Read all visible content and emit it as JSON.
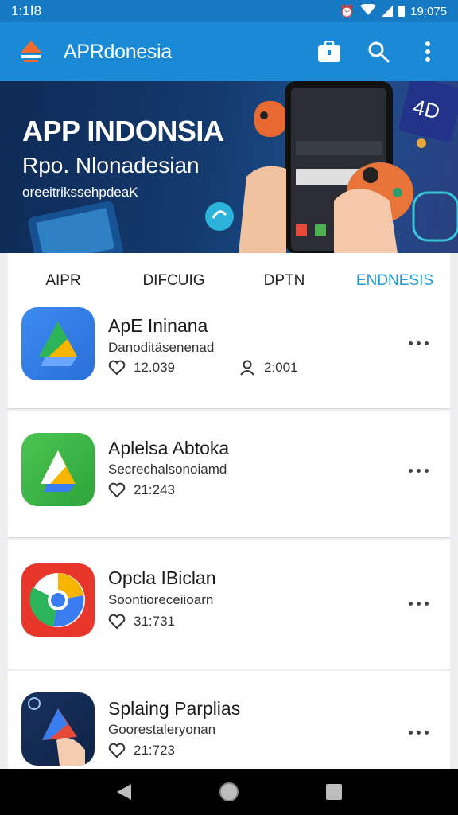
{
  "status_bar": {
    "time": "1:1Ⅰ8",
    "right_time": "19:075",
    "icons": [
      "alarm-icon",
      "wifi-icon",
      "signal-icon",
      "battery-icon"
    ]
  },
  "app_bar": {
    "title": "APRdonesia",
    "logo_icon": "app-logo-icon",
    "actions": [
      "briefcase-icon",
      "search-icon",
      "more-vert-icon"
    ]
  },
  "banner": {
    "title": "APP INDONSIA",
    "subtitle": "Rpo. Nlonadesian",
    "tagline": "oreeitrikssehpdeaK"
  },
  "tabs": [
    {
      "label": "AIPR",
      "active": false
    },
    {
      "label": "DIFCUIG",
      "active": false
    },
    {
      "label": "DPTN",
      "active": false
    },
    {
      "label": "ENDNESIS",
      "active": true
    }
  ],
  "apps": [
    {
      "name": "ApE  Ininana",
      "description": "Danoditäsenenad",
      "likes": "12.039",
      "users": "2:001",
      "icon": "drive-blue-icon"
    },
    {
      "name": "Aplelsa Abtoka",
      "description": "Secrechalsonoiamd",
      "likes": "21:243",
      "icon": "drive-green-icon"
    },
    {
      "name": "Opcla IBiclan",
      "description": "Soontioreceiioarn",
      "likes": "31:731",
      "icon": "chrome-red-icon"
    },
    {
      "name": "Splaing Parplias",
      "description": "Goorestaleryonan",
      "likes": "21:723",
      "icon": "hand-triangle-icon"
    }
  ],
  "colors": {
    "status_bar": "#1679c4",
    "app_bar": "#1b8ad6",
    "active_tab": "#1e9bd8"
  },
  "nav_bar": [
    "back-icon",
    "home-icon",
    "recents-icon"
  ]
}
